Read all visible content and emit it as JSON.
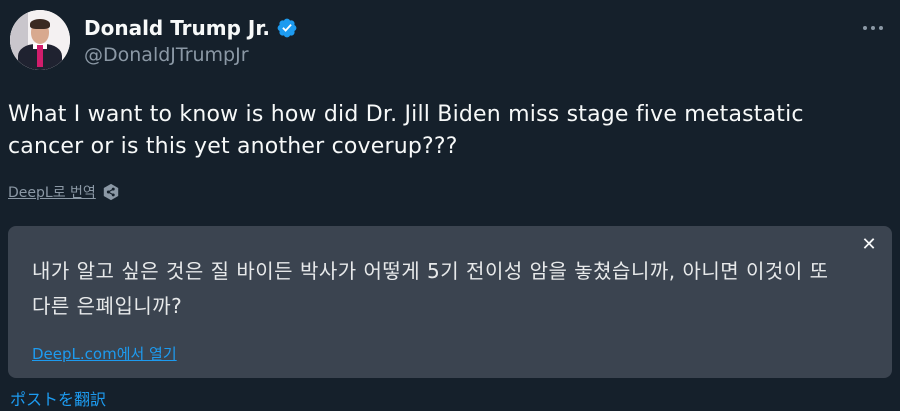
{
  "author": {
    "display_name": "Donald Trump Jr.",
    "handle": "@DonaldJTrumpJr",
    "avatar_icon": "profile-photo",
    "verified_icon": "verified-badge-icon"
  },
  "tweet": {
    "text": "What I want to know is how did Dr. Jill Biden miss stage five metastatic cancer or is this yet another coverup???"
  },
  "deepl": {
    "translate_label": "DeepL로 번역",
    "logo_icon": "deepl-logo-icon"
  },
  "translation": {
    "text": "내가 알고 싶은 것은 질 바이든 박사가 어떻게 5기 전이성 암을 놓쳤습니까, 아니면 이것이 또 다른 은폐입니까?",
    "open_link": "DeepL.com에서 열기",
    "close_icon": "close-icon",
    "close_glyph": "✕"
  },
  "translate_post_label": "ポストを翻訳",
  "colors": {
    "background": "#15202b",
    "card": "#3b4450",
    "link": "#1d9bf0",
    "verified": "#1d9bf0",
    "muted": "#8b98a5"
  }
}
